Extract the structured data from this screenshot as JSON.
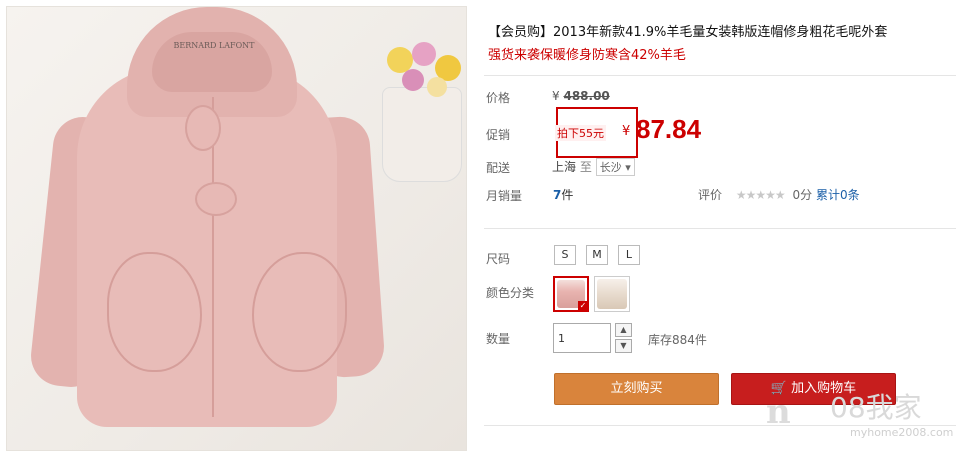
{
  "product": {
    "title": "【会员购】2013年新款41.9%羊毛量女装韩版连帽修身粗花毛呢外套",
    "subtitle": "强货来袭保暖修身防寒含42%羊毛"
  },
  "image": {
    "tag_text": "BERNARD LAFONT"
  },
  "labels": {
    "price": "价格",
    "promo": "促销",
    "shipping": "配送",
    "monthly_sales": "月销量",
    "size": "尺码",
    "color": "颜色分类",
    "quantity": "数量"
  },
  "price": {
    "currency": "¥",
    "original": "488.00"
  },
  "promo": {
    "tag": "拍下55元",
    "currency": "¥",
    "price": "87.84"
  },
  "shipping": {
    "from": "上海",
    "to": "至",
    "destination": "长沙"
  },
  "sales": {
    "count": "7",
    "unit": "件"
  },
  "rating": {
    "label": "评价",
    "stars": "★★★★★",
    "score": "0分",
    "review_count": "累计0条"
  },
  "sizes": [
    "S",
    "M",
    "L"
  ],
  "colors": [
    {
      "name": "pink",
      "hex": "#e8b4b0",
      "selected": true
    },
    {
      "name": "beige",
      "hex": "#e9ddd0",
      "selected": false
    }
  ],
  "quantity": {
    "value": "1",
    "up": "▲",
    "down": "▼",
    "stock": "库存884件"
  },
  "actions": {
    "buy_now": "立刻购买",
    "add_to_cart": "加入购物车",
    "cart_icon": "🛒"
  },
  "watermark": {
    "logo": "n",
    "text": "08我家",
    "url": "myhome2008.com"
  }
}
